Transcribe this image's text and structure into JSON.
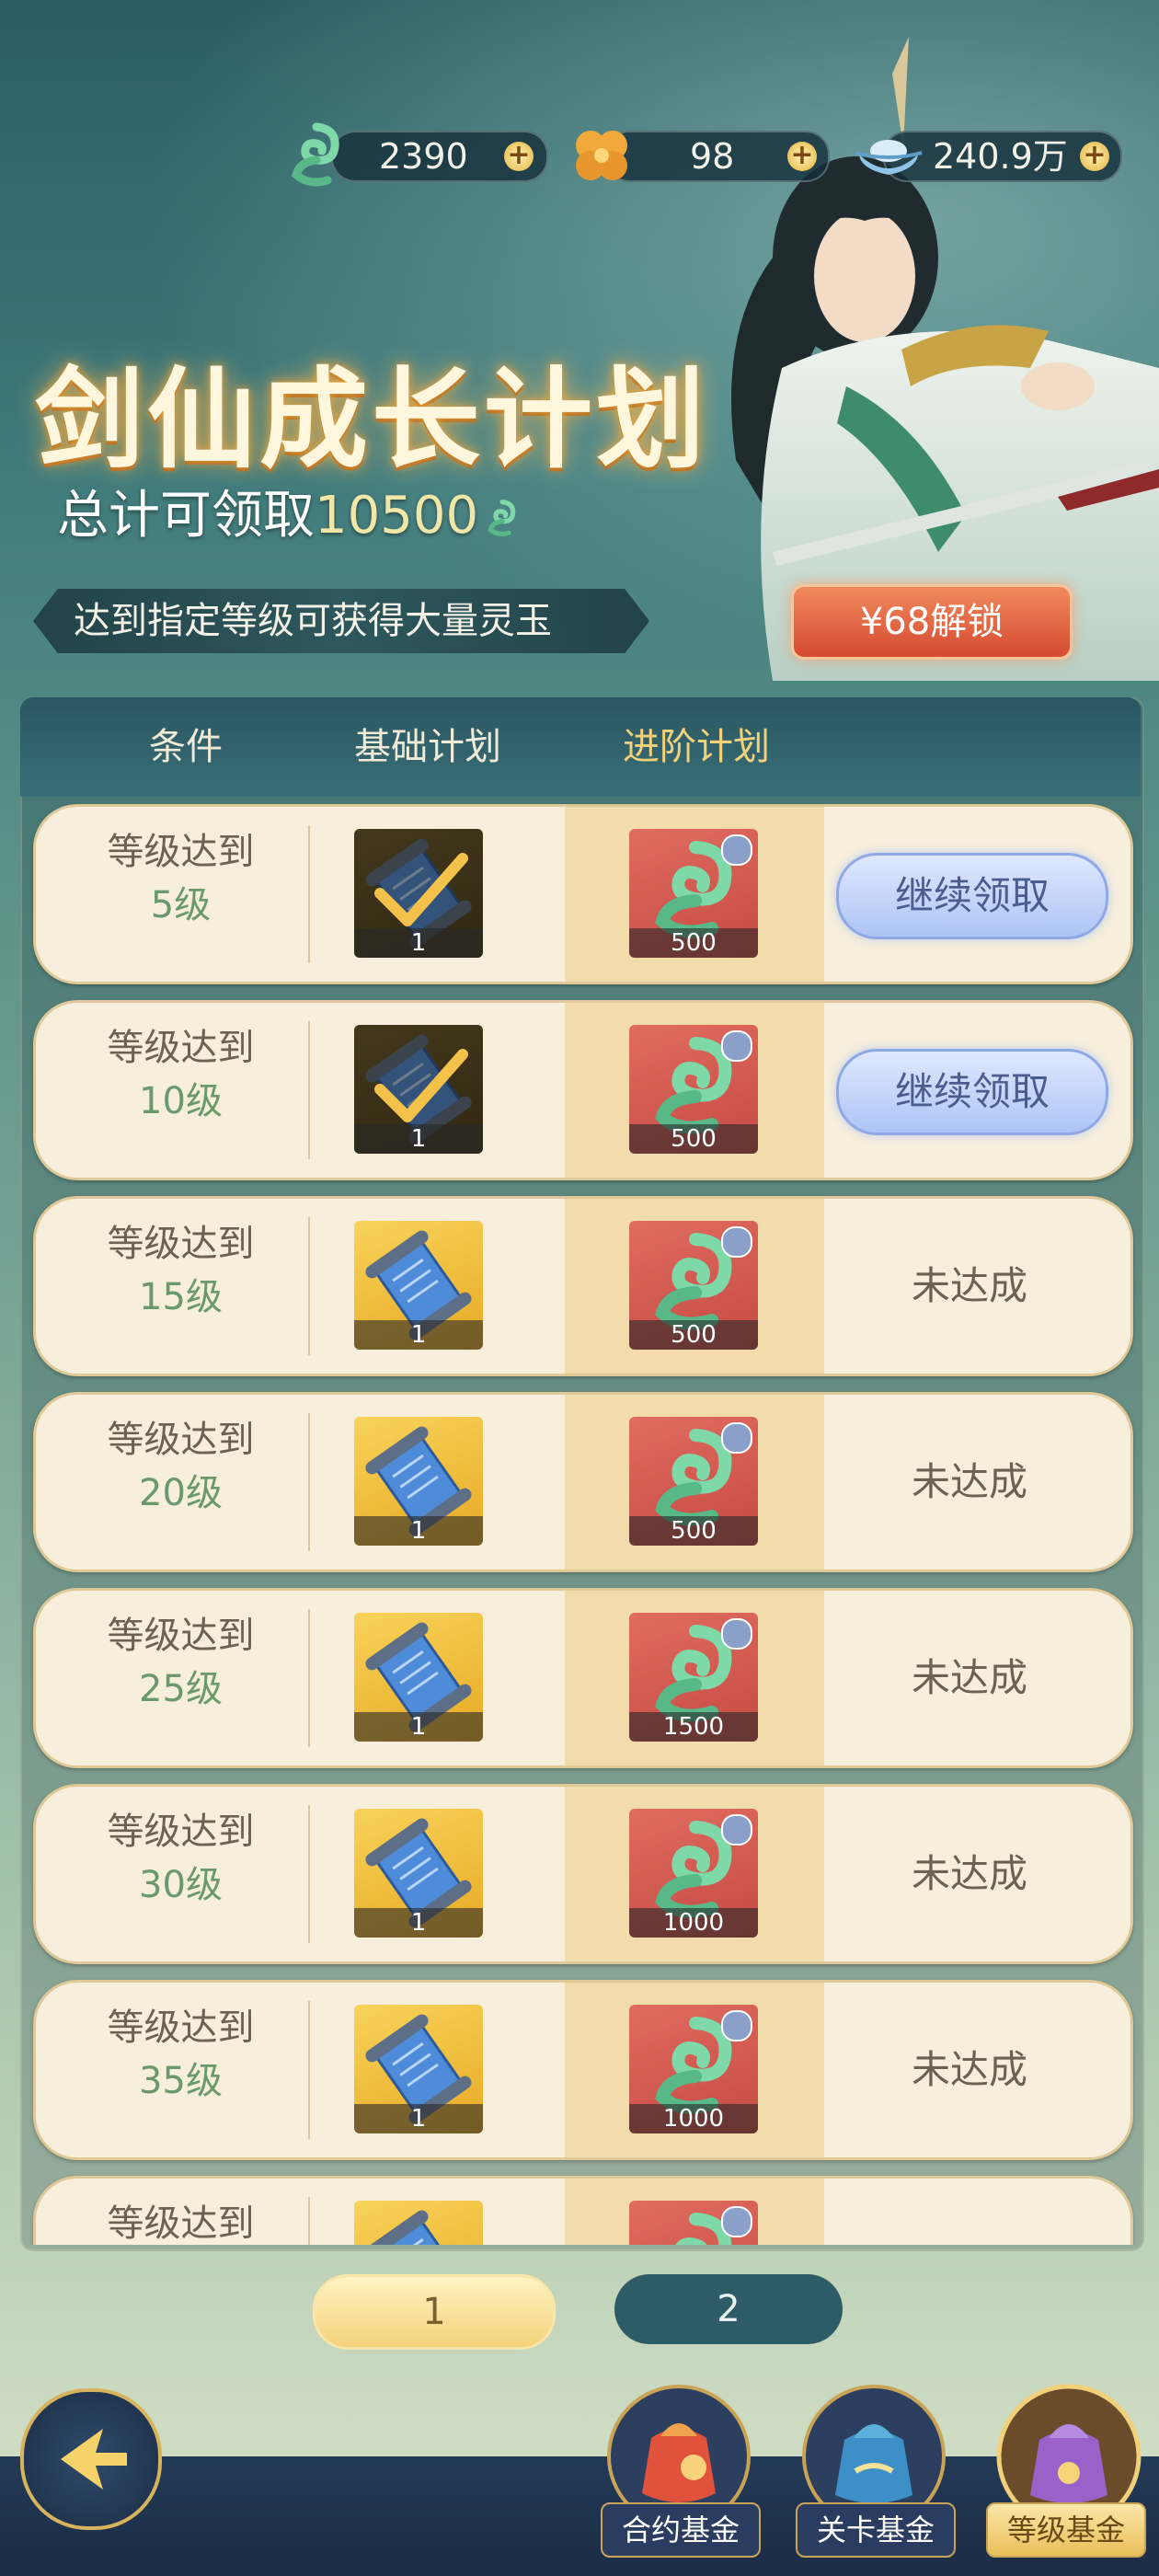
{
  "currencies": [
    {
      "icon": "jade-icon",
      "value": "2390"
    },
    {
      "icon": "clover-coin-icon",
      "value": "98"
    },
    {
      "icon": "silver-ingot-icon",
      "value": "240.9万"
    }
  ],
  "hero": {
    "title": "剑仙成长计划",
    "total_prefix": "总计可领取",
    "total_value": "10500",
    "banner": "达到指定等级可获得大量灵玉",
    "unlock_button": "¥68解锁"
  },
  "table": {
    "headers": [
      "条件",
      "基础计划",
      "进阶计划"
    ],
    "rows": [
      {
        "condition": "等级达到",
        "level": "5级",
        "basic_count": "1",
        "basic_claimed": true,
        "adv_count": "500",
        "action": "继续领取",
        "actionable": true
      },
      {
        "condition": "等级达到",
        "level": "10级",
        "basic_count": "1",
        "basic_claimed": true,
        "adv_count": "500",
        "action": "继续领取",
        "actionable": true
      },
      {
        "condition": "等级达到",
        "level": "15级",
        "basic_count": "1",
        "basic_claimed": false,
        "adv_count": "500",
        "action": "未达成",
        "actionable": false
      },
      {
        "condition": "等级达到",
        "level": "20级",
        "basic_count": "1",
        "basic_claimed": false,
        "adv_count": "500",
        "action": "未达成",
        "actionable": false
      },
      {
        "condition": "等级达到",
        "level": "25级",
        "basic_count": "1",
        "basic_claimed": false,
        "adv_count": "1500",
        "action": "未达成",
        "actionable": false
      },
      {
        "condition": "等级达到",
        "level": "30级",
        "basic_count": "1",
        "basic_claimed": false,
        "adv_count": "1000",
        "action": "未达成",
        "actionable": false
      },
      {
        "condition": "等级达到",
        "level": "35级",
        "basic_count": "1",
        "basic_claimed": false,
        "adv_count": "1000",
        "action": "未达成",
        "actionable": false
      },
      {
        "condition": "等级达到",
        "level": "",
        "basic_count": "",
        "basic_claimed": false,
        "adv_count": "",
        "action": "",
        "actionable": false
      }
    ]
  },
  "pagination": {
    "pages": [
      "1",
      "2"
    ],
    "active": "1"
  },
  "nav": {
    "back_icon": "back-arrow-icon",
    "tabs": [
      {
        "label": "合约基金",
        "icon": "red-pouch-icon",
        "active": false
      },
      {
        "label": "关卡基金",
        "icon": "blue-pouch-icon",
        "active": false
      },
      {
        "label": "等级基金",
        "icon": "purple-pouch-icon",
        "active": true
      }
    ]
  }
}
